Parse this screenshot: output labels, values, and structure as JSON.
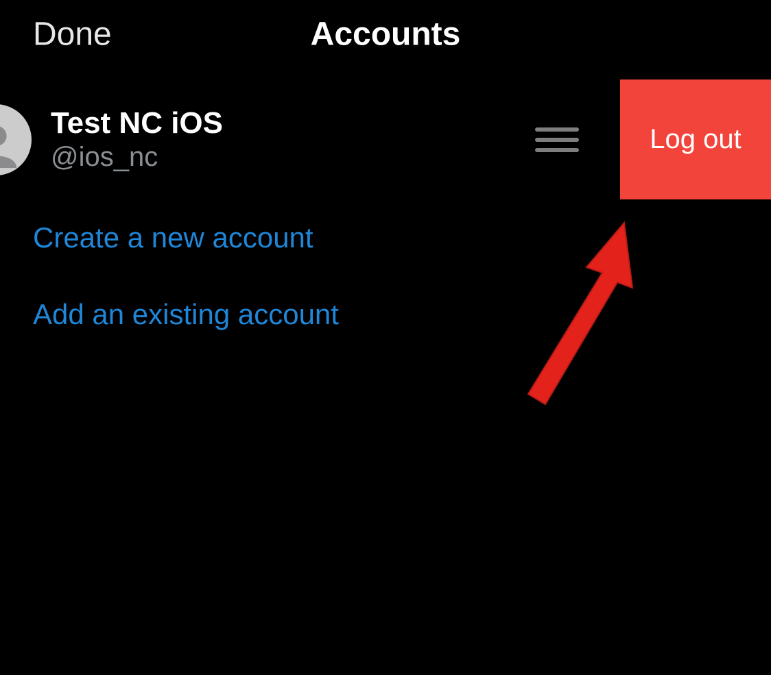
{
  "header": {
    "done_label": "Done",
    "title": "Accounts"
  },
  "account": {
    "display_name": "Test NC iOS",
    "handle": "@ios_nc",
    "logout_label": "Log out"
  },
  "actions": {
    "create_label": "Create a new account",
    "add_existing_label": "Add an existing account"
  },
  "colors": {
    "background": "#000000",
    "link": "#1f86d8",
    "logout_bg": "#f2443b",
    "handle_text": "#8a8f94",
    "drag_bar": "#7e7e7e"
  }
}
